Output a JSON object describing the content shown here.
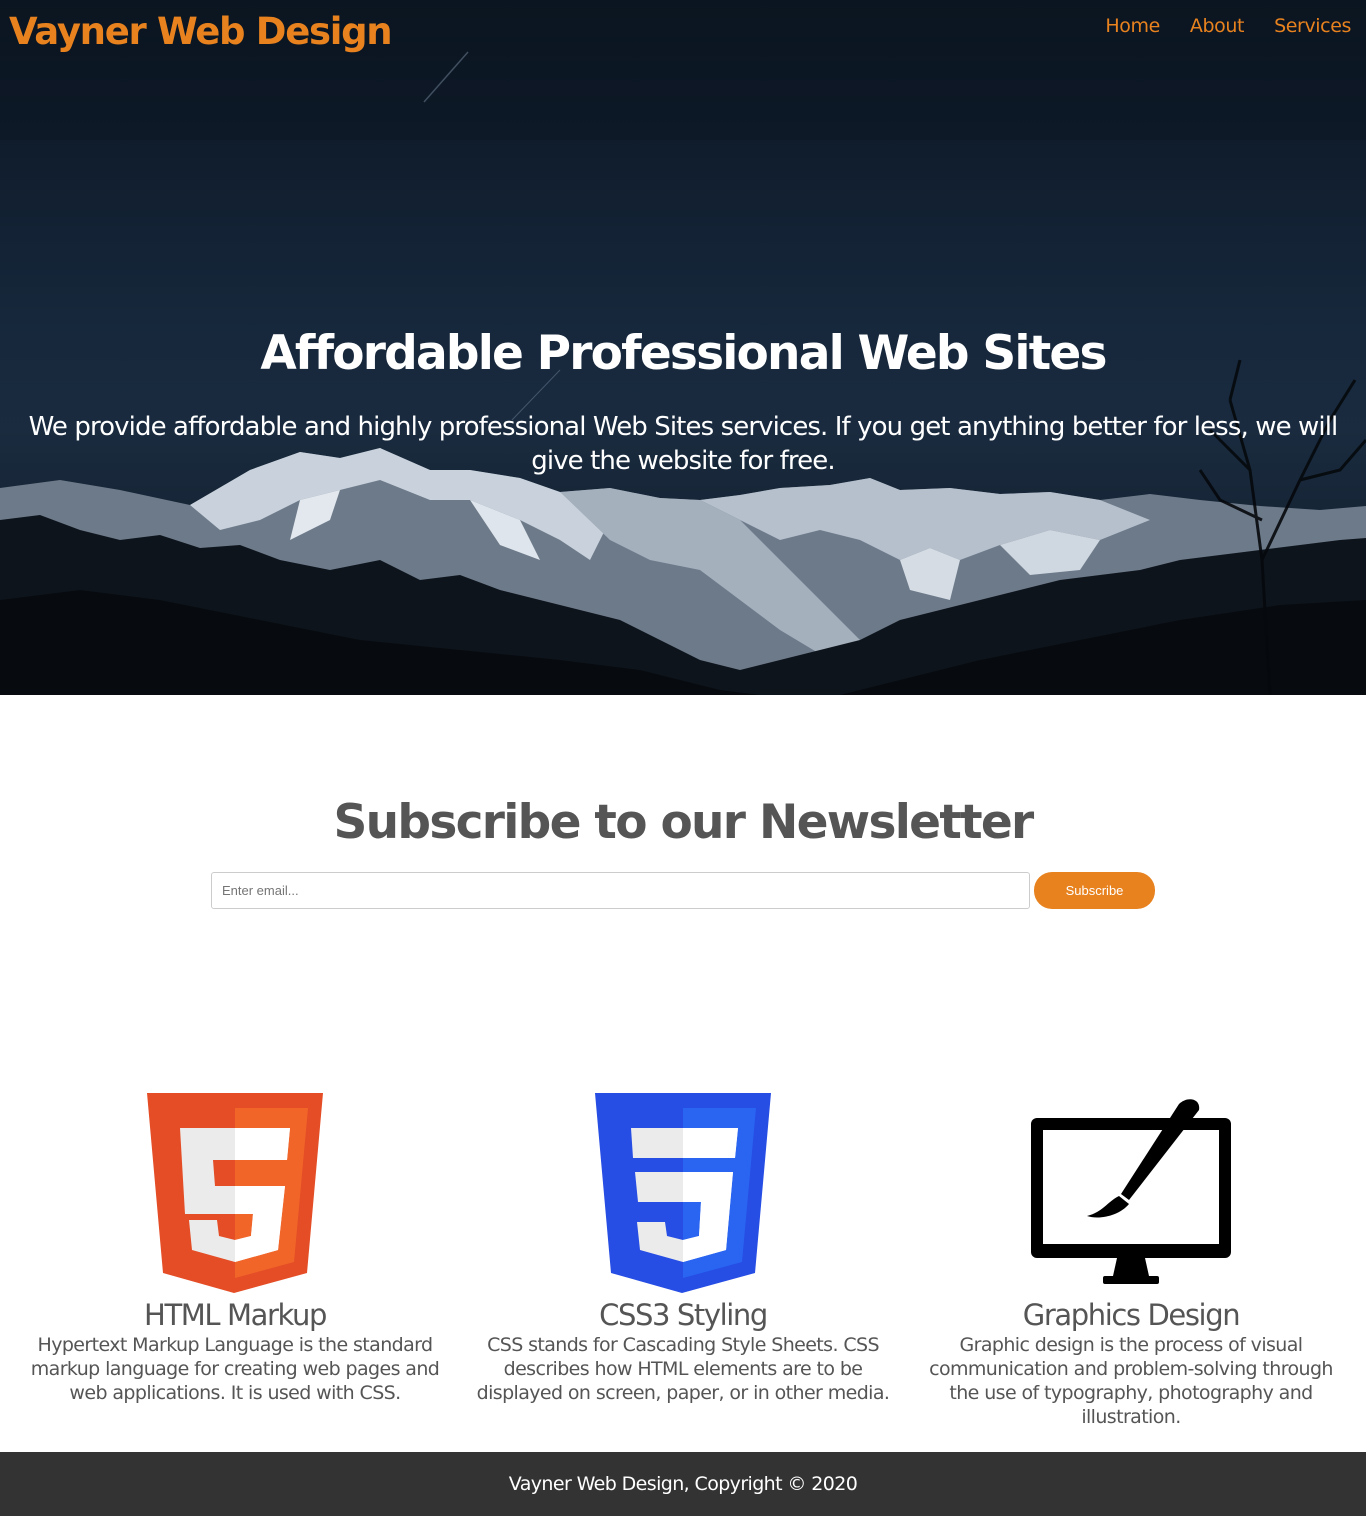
{
  "header": {
    "brand": "Vayner Web Design",
    "nav": [
      {
        "label": "Home"
      },
      {
        "label": "About"
      },
      {
        "label": "Services"
      }
    ]
  },
  "hero": {
    "title": "Affordable Professional Web Sites",
    "text": "We provide affordable and highly professional Web Sites services. If you get anything better for less, we will give the website for free."
  },
  "newsletter": {
    "title": "Subscribe to our Newsletter",
    "email_placeholder": "Enter email...",
    "email_value": "",
    "button_label": "Subscribe"
  },
  "features": [
    {
      "icon": "html5-logo-icon",
      "title": "HTML Markup",
      "text": "Hypertext Markup Language is the standard markup language for creating web pages and web applications. It is used with CSS."
    },
    {
      "icon": "css3-logo-icon",
      "title": "CSS3 Styling",
      "text": "CSS stands for Cascading Style Sheets. CSS describes how HTML elements are to be displayed on screen, paper, or in other media."
    },
    {
      "icon": "monitor-brush-icon",
      "title": "Graphics Design",
      "text": "Graphic design is the process of visual communication and problem-solving through the use of typography, photography and illustration."
    }
  ],
  "footer": {
    "text": "Vayner Web Design, Copyright © 2020"
  },
  "colors": {
    "accent": "#e8821f",
    "text": "#555555",
    "footer_bg": "#333333",
    "html5_orange": "#e44d26",
    "css3_blue": "#264de4"
  }
}
